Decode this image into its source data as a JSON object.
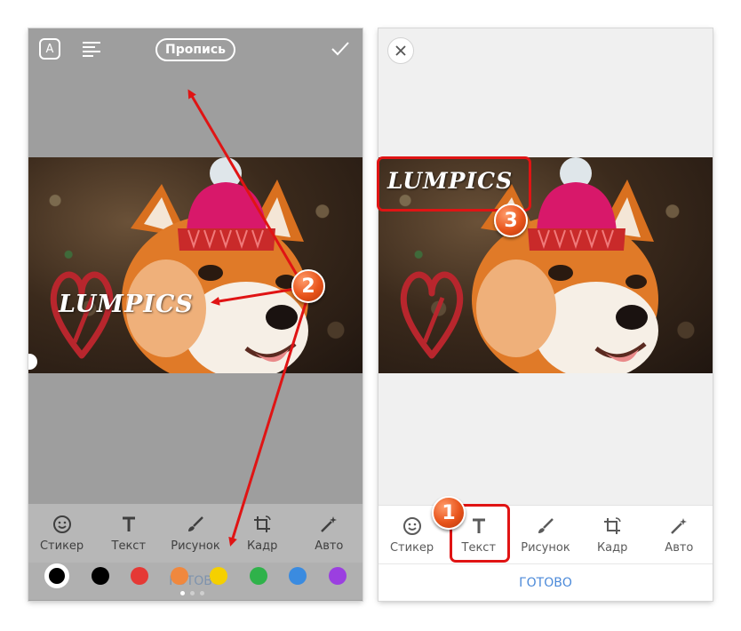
{
  "left_screen": {
    "topbar": {
      "font_label": "A",
      "style_label": "Пропись"
    },
    "overlay_text": "LUMPICS",
    "toolbar": [
      {
        "label": "Стикер",
        "icon": "smiley-icon"
      },
      {
        "label": "Текст",
        "icon": "text-t-icon"
      },
      {
        "label": "Рисунок",
        "icon": "brush-icon"
      },
      {
        "label": "Кадр",
        "icon": "crop-icon"
      },
      {
        "label": "Авто",
        "icon": "magic-wand-icon"
      }
    ],
    "ready_label": "ГОТОВО",
    "palette": [
      "#ffffff",
      "#000000",
      "#e53935",
      "#f0883e",
      "#f5d000",
      "#2fb24a",
      "#3a8be0",
      "#9b3fe0"
    ]
  },
  "right_screen": {
    "overlay_text": "LUMPICS",
    "toolbar": [
      {
        "label": "Стикер",
        "icon": "smiley-icon"
      },
      {
        "label": "Текст",
        "icon": "text-t-icon"
      },
      {
        "label": "Рисунок",
        "icon": "brush-icon"
      },
      {
        "label": "Кадр",
        "icon": "crop-icon"
      },
      {
        "label": "Авто",
        "icon": "magic-wand-icon"
      }
    ],
    "ready_label": "ГОТОВО"
  },
  "annotations": {
    "badges": [
      "1",
      "2",
      "3"
    ],
    "color": "#e01414"
  }
}
